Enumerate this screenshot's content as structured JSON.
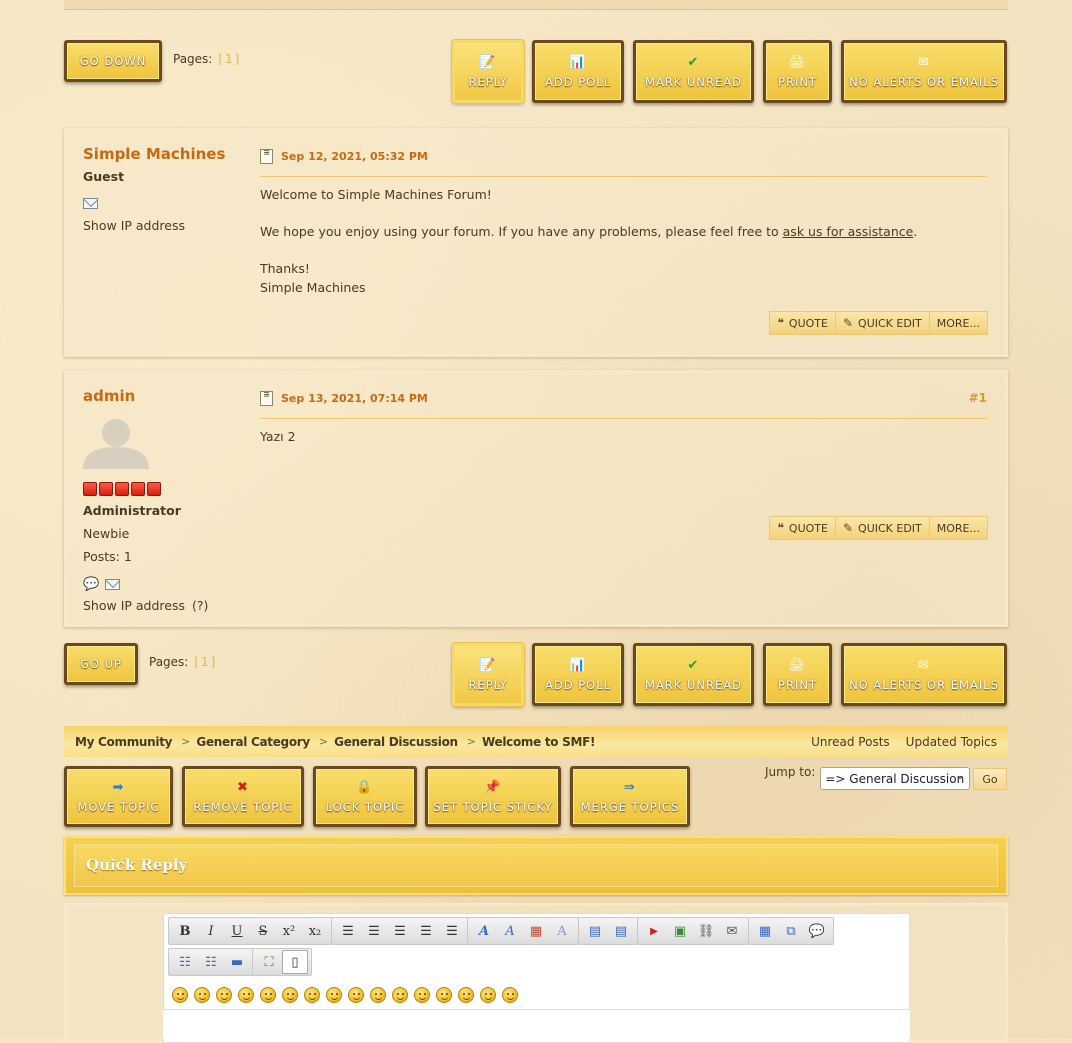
{
  "pagination_top": {
    "go_down": "Go Down",
    "pages_label": "Pages:",
    "current_page": "[1]"
  },
  "pagination_bottom": {
    "go_up": "Go Up",
    "pages_label": "Pages:",
    "current_page": "[1]"
  },
  "topic_buttons": {
    "reply": "Reply",
    "add_poll": "Add Poll",
    "mark_unread": "Mark unread",
    "print": "Print",
    "no_alerts": "No Alerts or Emails"
  },
  "posts": [
    {
      "author": "Simple Machines",
      "group": "Guest",
      "show_ip": "Show IP address",
      "date": "Sep 12, 2021, 05:32 PM",
      "body": {
        "line1": "Welcome to Simple Machines Forum!",
        "line2_prefix": "We hope you enjoy using your forum.  If you have any problems, please feel free to ",
        "line2_link": "ask us for assistance",
        "line2_suffix": ".",
        "line3": "Thanks!",
        "line4": "Simple Machines"
      },
      "actions": {
        "quote": "Quote",
        "quick_edit": "Quick Edit",
        "more": "More..."
      }
    },
    {
      "author": "admin",
      "stars": 5,
      "group": "Administrator",
      "rank": "Newbie",
      "posts": "Posts: 1",
      "show_ip": "Show IP address",
      "ip_help": "(?)",
      "date": "Sep 13, 2021, 07:14 PM",
      "number": "#1",
      "body": "Yazı 2",
      "actions": {
        "quote": "Quote",
        "quick_edit": "Quick Edit",
        "more": "More..."
      }
    }
  ],
  "breadcrumb": {
    "items": [
      "My Community",
      "General Category",
      "General Discussion",
      "Welcome to SMF!"
    ],
    "unread_posts": "Unread Posts",
    "updated_topics": "Updated Topics"
  },
  "mod_buttons": {
    "move": "Move Topic",
    "remove": "Remove Topic",
    "lock": "Lock Topic",
    "sticky": "Set topic sticky",
    "merge": "Merge Topics"
  },
  "jump": {
    "label": "Jump to:",
    "selected": "=> General Discussion",
    "go": "Go"
  },
  "quick_reply": {
    "title": "Quick Reply"
  },
  "colors": {
    "accent": "#c66a12",
    "button": "#f1c846",
    "button_border": "#6a4a1c"
  }
}
